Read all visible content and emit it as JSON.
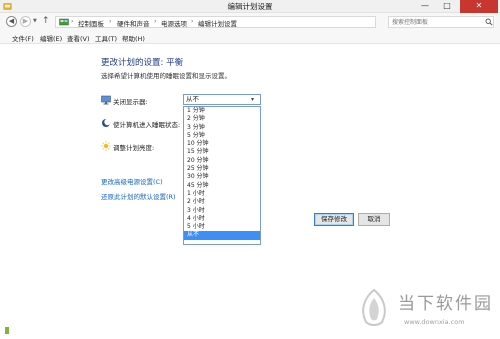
{
  "window": {
    "title": "编辑计划设置",
    "min_glyph": "—",
    "max_glyph": "□",
    "close_glyph": "✕"
  },
  "address": {
    "back_glyph": "◀",
    "forward_glyph": "▶",
    "history_glyph": "▼",
    "up_glyph": "↑",
    "sep_glyph": "›",
    "dropdown_glyph": "▼",
    "refresh_glyph": "↻",
    "breadcrumbs": [
      "控制面板",
      "硬件和声音",
      "电源选项",
      "编辑计划设置"
    ],
    "search_placeholder": "搜索控制面板"
  },
  "menu": {
    "items": [
      "文件(F)",
      "编辑(E)",
      "查看(V)",
      "工具(T)",
      "帮助(H)"
    ]
  },
  "main": {
    "heading": "更改计划的设置: 平衡",
    "description": "选择希望计算机使用的睡眠设置和显示设置。",
    "rows": [
      {
        "label": "关闭显示器:",
        "icon": "monitor-icon"
      },
      {
        "label": "使计算机进入睡眠状态:",
        "icon": "moon-icon"
      },
      {
        "label": "调整计划亮度:",
        "icon": "sun-icon"
      }
    ],
    "display_off_select": {
      "value": "从不",
      "arrow_glyph": "▾",
      "options": [
        "1 分钟",
        "2 分钟",
        "3 分钟",
        "5 分钟",
        "10 分钟",
        "15 分钟",
        "20 分钟",
        "25 分钟",
        "30 分钟",
        "45 分钟",
        "1 小时",
        "2 小时",
        "3 小时",
        "4 小时",
        "5 小时",
        "从不"
      ],
      "selected_index": 15
    },
    "links": {
      "advanced": "更改高级电源设置(C)",
      "restore": "还原此计划的默认设置(R)"
    },
    "buttons": {
      "save": "保存修改",
      "cancel": "取消"
    }
  },
  "watermark": {
    "title": "当下软件园",
    "url": "www.downxia.com"
  },
  "colors": {
    "accent": "#1463c4",
    "heading": "#1e3a8a",
    "selection": "#3e8ef7",
    "close_button": "#c7372f"
  }
}
